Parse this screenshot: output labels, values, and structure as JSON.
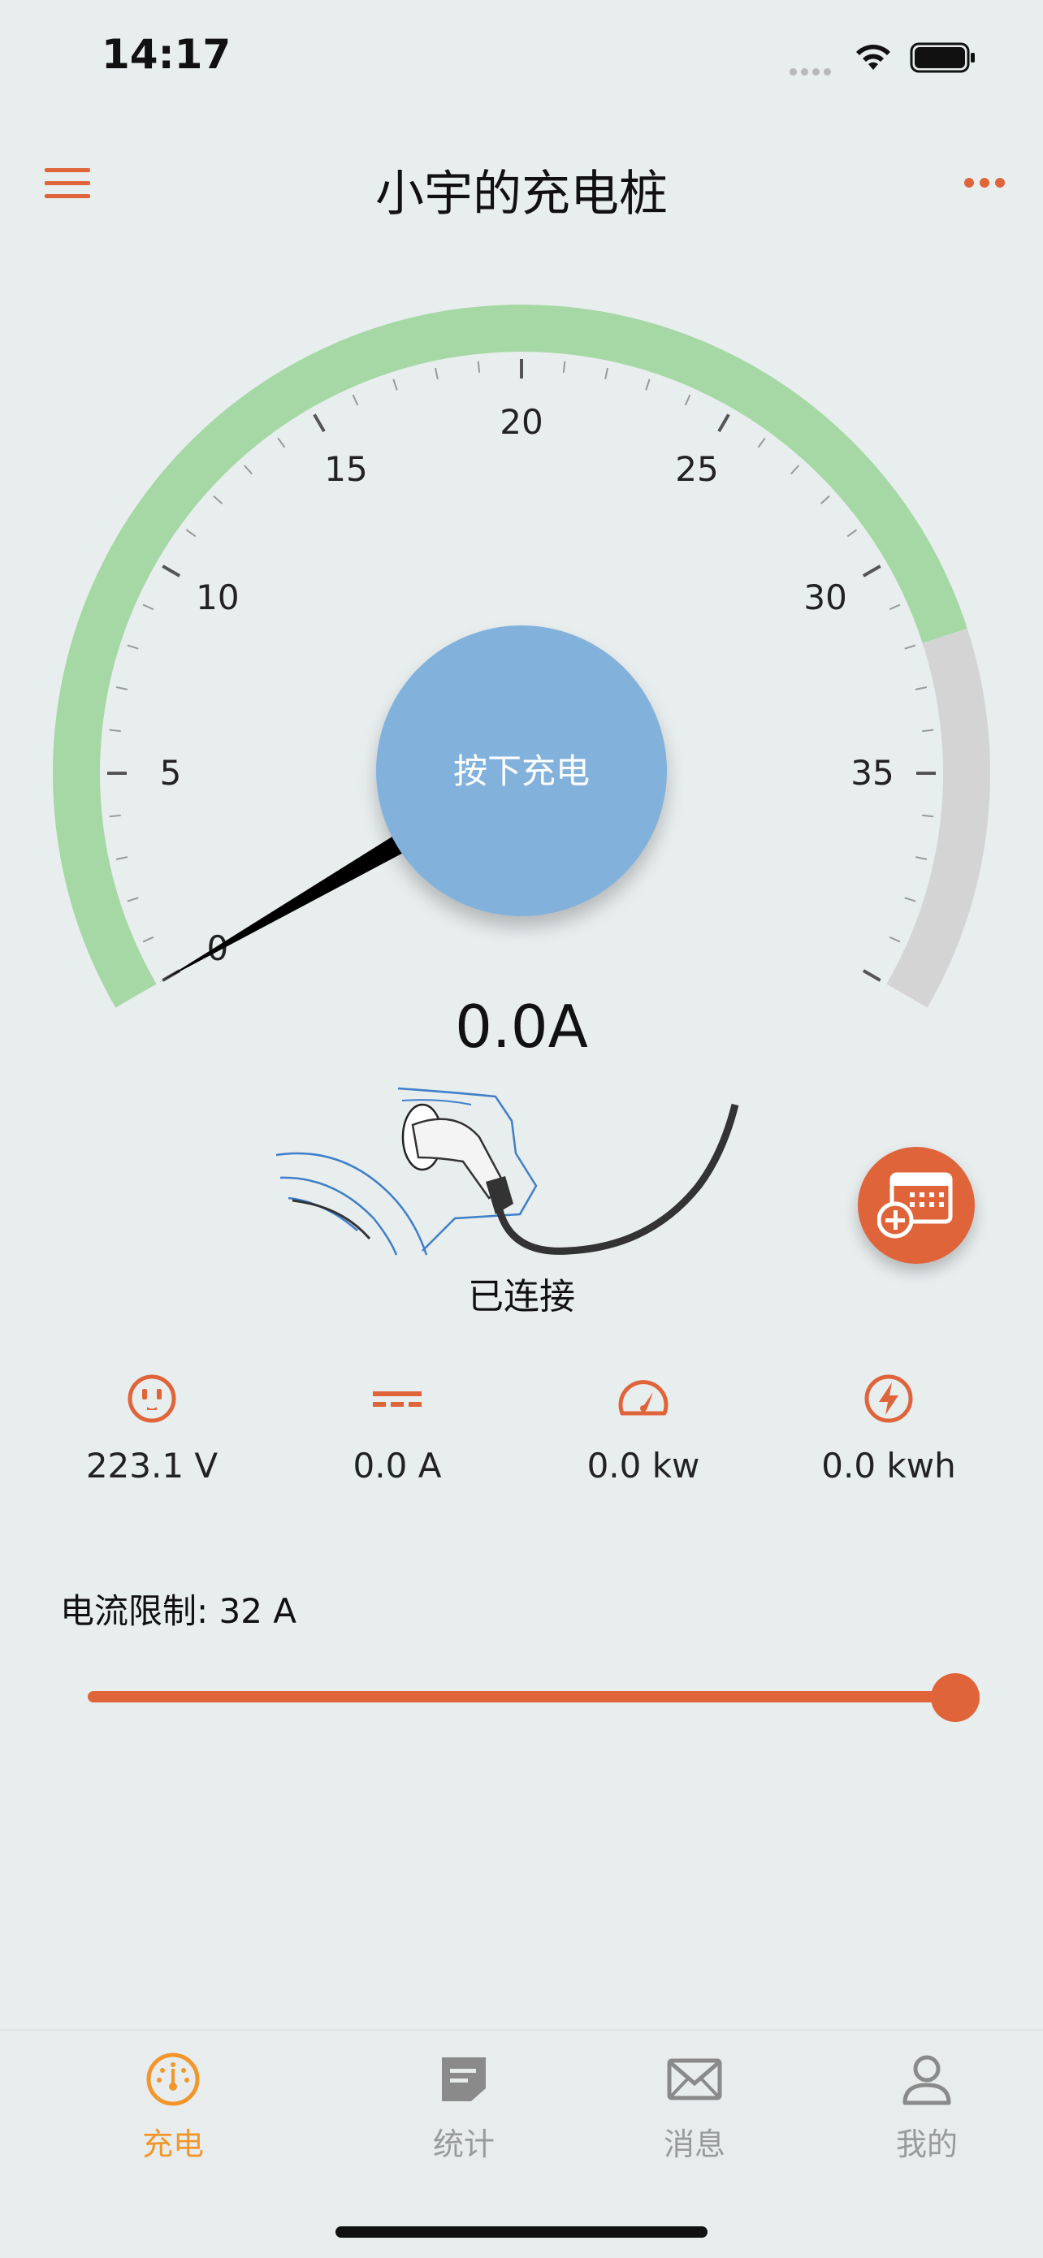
{
  "status_bar": {
    "time": "14:17"
  },
  "header": {
    "title": "小宇的充电桩"
  },
  "gauge": {
    "tick_labels": [
      "0",
      "5",
      "10",
      "15",
      "20",
      "25",
      "30",
      "35"
    ],
    "min": 0,
    "max": 40,
    "safe_max": 32,
    "needle_value": 0,
    "arc_color_safe": "#a5d8a5",
    "arc_color_over": "#d4d4d4",
    "button_label": "按下充电",
    "current_readout": "0.0A"
  },
  "connection": {
    "status": "已连接"
  },
  "stats": [
    {
      "icon": "outlet-icon",
      "value": "223.1 V"
    },
    {
      "icon": "dc-current-icon",
      "value": "0.0 A"
    },
    {
      "icon": "speedometer-icon",
      "value": "0.0 kw"
    },
    {
      "icon": "lightning-icon",
      "value": "0.0 kwh"
    }
  ],
  "current_limit": {
    "label": "电流限制: 32 A",
    "value": 32,
    "fraction": 1.0
  },
  "tabs": [
    {
      "label": "充电",
      "icon": "gauge-icon",
      "active": true
    },
    {
      "label": "统计",
      "icon": "document-icon",
      "active": false
    },
    {
      "label": "消息",
      "icon": "mail-icon",
      "active": false
    },
    {
      "label": "我的",
      "icon": "user-icon",
      "active": false
    }
  ],
  "colors": {
    "accent": "#e0643a",
    "active_tab": "#f2962b",
    "button": "#82b2dc"
  }
}
